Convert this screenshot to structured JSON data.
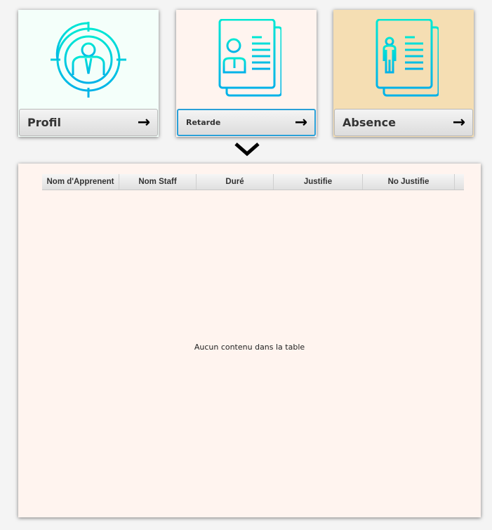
{
  "cards": [
    {
      "label": "Profil",
      "bg": "#f4fffa"
    },
    {
      "label": "Retarde",
      "bg": "#fff4ef"
    },
    {
      "label": "Absence",
      "bg": "#f5deb3"
    }
  ],
  "table": {
    "columns": [
      "Nom d'Apprenent",
      "Nom Staff",
      "Duré",
      "Justifie",
      "No Justifie"
    ],
    "empty_text": "Aucun contenu dans la table"
  },
  "colors": {
    "icon_top": "#00e6d2",
    "icon_bottom": "#00b4e6",
    "focus": "#2aa0d8"
  }
}
